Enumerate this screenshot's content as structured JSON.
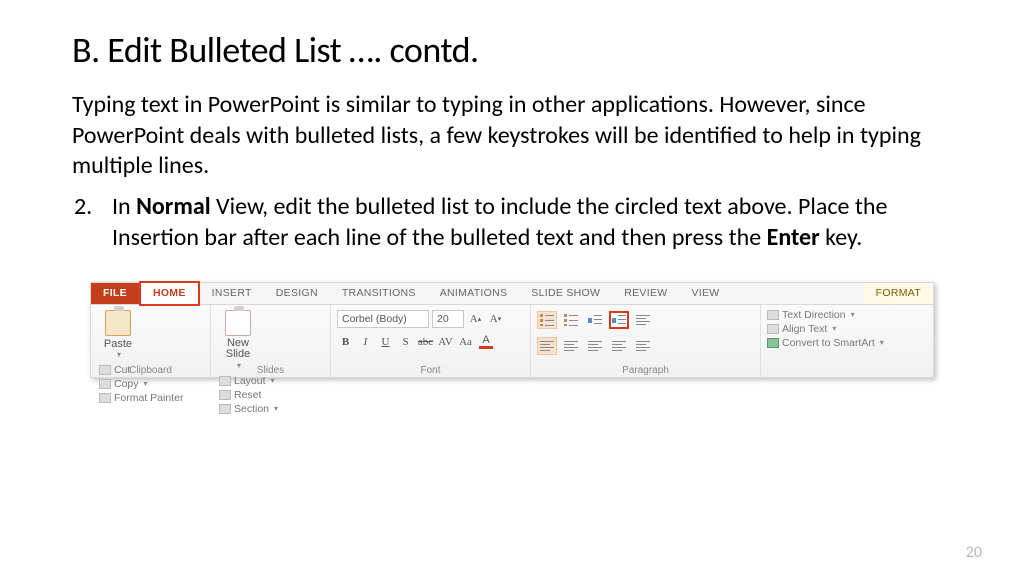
{
  "title": "B. Edit Bulleted List   …. contd.",
  "intro": "Typing text in PowerPoint is similar to typing in other applications. However, since PowerPoint deals with bulleted lists, a few keystrokes will be identified to help in typing multiple lines.",
  "step": {
    "number": "2.",
    "pre": "In ",
    "bold1": "Normal",
    "mid": " View, edit the bulleted list to include the circled text above. Place the Insertion bar after each line of the bulleted text and then press the ",
    "bold2": "Enter",
    "post": " key."
  },
  "ribbon": {
    "tabs": {
      "file": "FILE",
      "home": "HOME",
      "insert": "INSERT",
      "design": "DESIGN",
      "transitions": "TRANSITIONS",
      "animations": "ANIMATIONS",
      "slideshow": "SLIDE SHOW",
      "review": "REVIEW",
      "view": "VIEW",
      "format": "FORMAT"
    },
    "clipboard": {
      "paste": "Paste",
      "cut": "Cut",
      "copy": "Copy",
      "painter": "Format Painter",
      "label": "Clipboard"
    },
    "slides": {
      "new": "New Slide",
      "layout": "Layout",
      "reset": "Reset",
      "section": "Section",
      "label": "Slides"
    },
    "font": {
      "name": "Corbel (Body)",
      "size": "20",
      "b": "B",
      "i": "I",
      "u": "U",
      "s": "S",
      "abc": "abc",
      "av": "AV",
      "aa": "Aa",
      "a": "A",
      "label": "Font"
    },
    "paragraph": {
      "label": "Paragraph"
    },
    "shape": {
      "textdir": "Text Direction",
      "align": "Align Text",
      "smart": "Convert to SmartArt",
      "_label": ""
    }
  },
  "pagenum": "20"
}
